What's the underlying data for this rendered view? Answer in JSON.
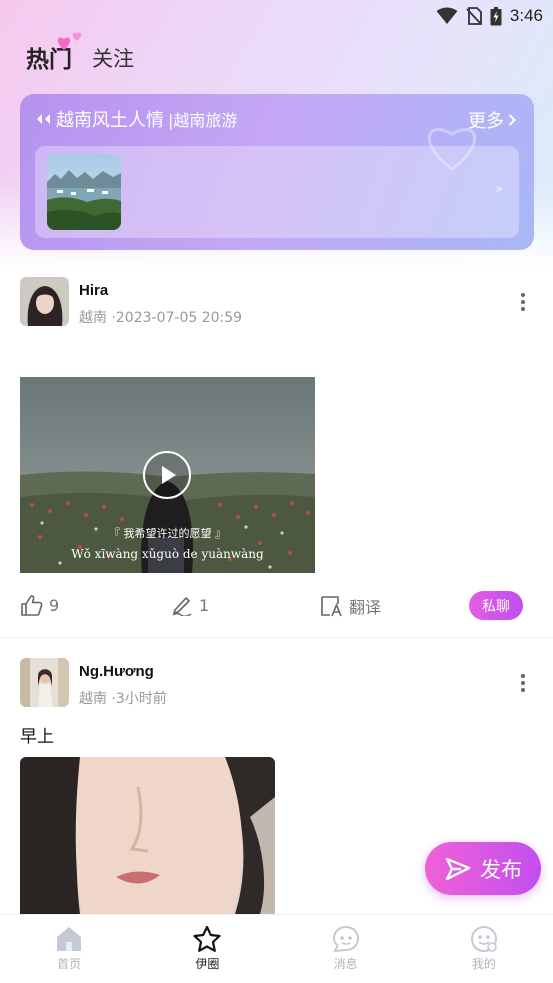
{
  "status_bar": {
    "time": "3:46"
  },
  "tabs": {
    "hot": "热门",
    "follow": "关注"
  },
  "banner": {
    "title_main": "越南风土人情",
    "title_sub": "|越南旅游",
    "more": "更多",
    "arrow": "»"
  },
  "posts": [
    {
      "username": "Hira",
      "meta": "越南 ·2023-07-05 20:59",
      "video_caption_cn": "『 我希望许过的愿望 』",
      "video_caption_pinyin": "Wǒ xīwàng xǔguò de yuànwàng",
      "likes": "9",
      "comments": "1",
      "translate": "翻译",
      "chat": "私聊"
    },
    {
      "username": "Ng.Hương",
      "meta": "越南 ·3小时前",
      "text": "早上"
    }
  ],
  "fab": {
    "label": "发布"
  },
  "bottom_nav": [
    {
      "label": "首页",
      "icon": "home-icon",
      "active": false
    },
    {
      "label": "伊圈",
      "icon": "star-icon",
      "active": true
    },
    {
      "label": "消息",
      "icon": "message-icon",
      "active": false
    },
    {
      "label": "我的",
      "icon": "profile-icon",
      "active": false
    }
  ],
  "colors": {
    "accent": "#c04cf2",
    "banner": "#b493f0",
    "muted": "#9a9a9a"
  }
}
